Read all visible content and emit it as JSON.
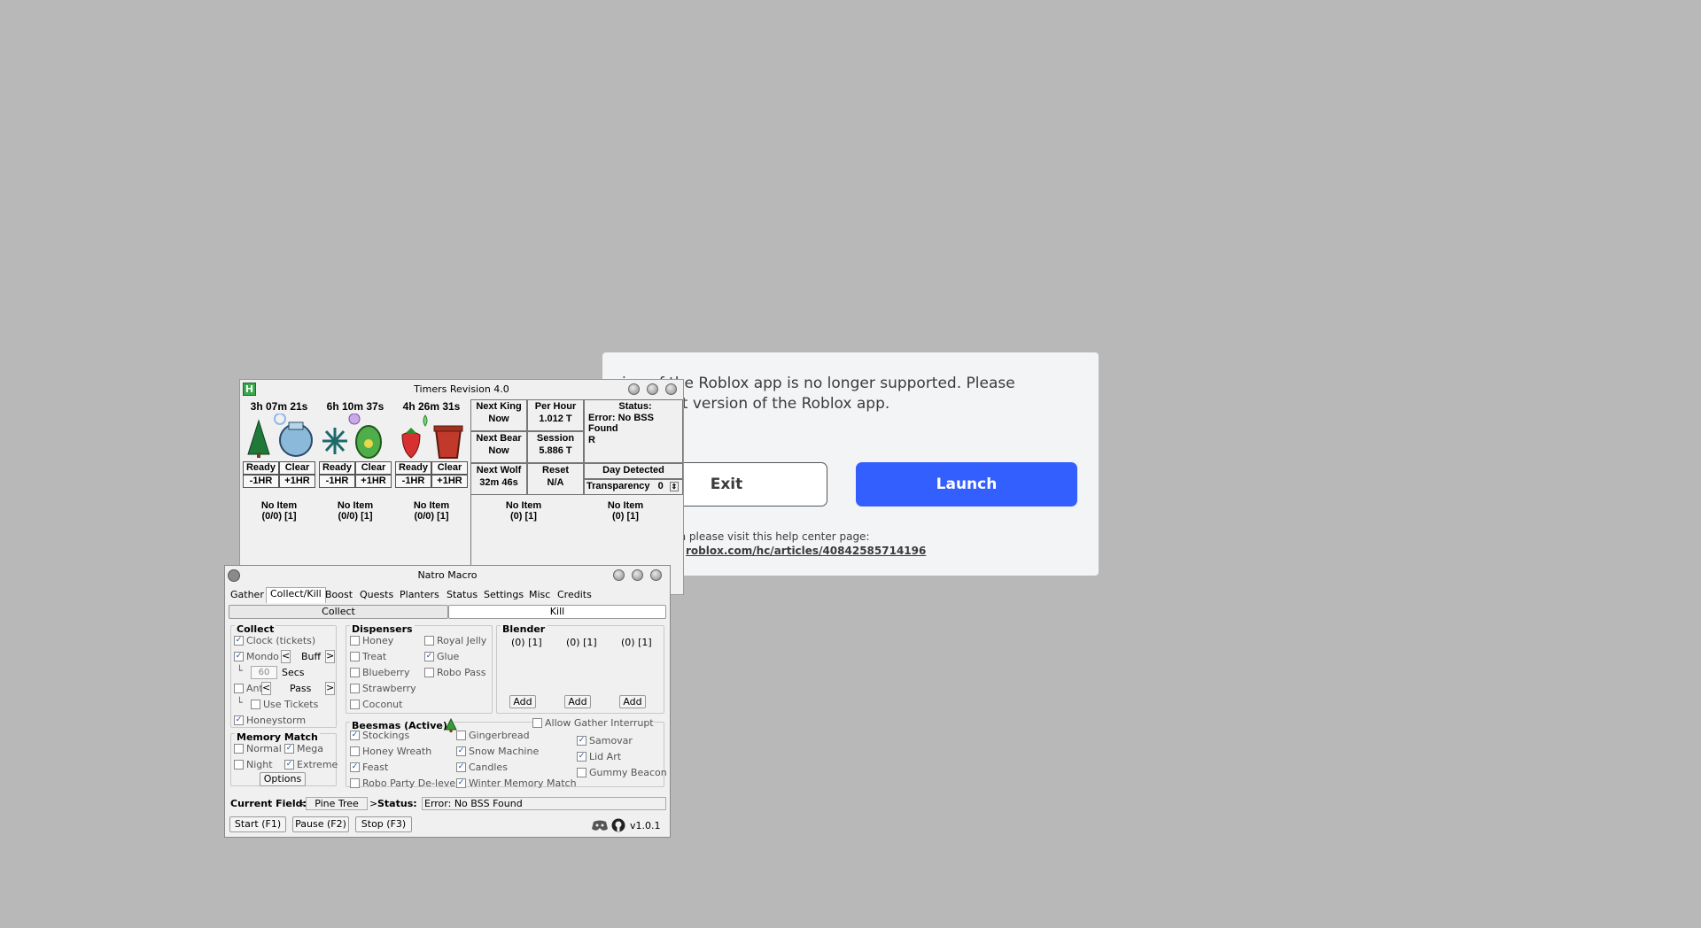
{
  "roblox": {
    "message": "ion of the Roblox app is no longer supported. Please\nhe latest version of the Roblox app.",
    "exit_label": "Exit",
    "launch_label": "Launch",
    "info_text": "ormation please visit this help center page:",
    "link_text": "roblox.com/hc/articles/40842585714196"
  },
  "timers": {
    "title": "Timers Revision 4.0",
    "planters": [
      {
        "time": "3h 07m 21s",
        "ready": "Ready",
        "clear": "Clear",
        "minus": "-1HR",
        "plus": "+1HR",
        "item": "No Item",
        "count": "(0/0) [1]"
      },
      {
        "time": "6h 10m 37s",
        "ready": "Ready",
        "clear": "Clear",
        "minus": "-1HR",
        "plus": "+1HR",
        "item": "No Item",
        "count": "(0/0) [1]"
      },
      {
        "time": "4h 26m 31s",
        "ready": "Ready",
        "clear": "Clear",
        "minus": "-1HR",
        "plus": "+1HR",
        "item": "No Item",
        "count": "(0/0) [1]"
      }
    ],
    "next_king_label": "Next King",
    "next_king_value": "Now",
    "next_bear_label": "Next Bear",
    "next_bear_value": "Now",
    "next_wolf_label": "Next Wolf",
    "next_wolf_value": "32m 46s",
    "per_hour_label": "Per Hour",
    "per_hour_value": "1.012 T",
    "session_label": "Session",
    "session_value": "5.886 T",
    "reset_label": "Reset",
    "reset_value": "N/A",
    "status_label": "Status:",
    "status_value": "Error: No BSS Found",
    "status_extra": "R",
    "day_label": "Day Detected",
    "transparency_label": "Transparency",
    "transparency_value": "0",
    "right_items": [
      {
        "item": "No Item",
        "count": "(0) [1]"
      },
      {
        "item": "No Item",
        "count": "(0) [1]"
      }
    ]
  },
  "natro": {
    "title": "Natro Macro",
    "tabs": [
      "Gather",
      "Collect/Kill",
      "Boost",
      "Quests",
      "Planters",
      "Status",
      "Settings",
      "Misc",
      "Credits"
    ],
    "collect_btn": "Collect",
    "kill_btn": "Kill",
    "collect": {
      "title": "Collect",
      "clock": "Clock (tickets)",
      "mondo": "Mondo",
      "mondo_option": "Buff",
      "secs_value": "60",
      "secs_label": "Secs",
      "ant": "Ant",
      "ant_option": "Pass",
      "use_tickets": "Use Tickets",
      "honeystorm": "Honeystorm"
    },
    "memory": {
      "title": "Memory Match",
      "normal": "Normal",
      "mega": "Mega",
      "night": "Night",
      "extreme": "Extreme",
      "options": "Options"
    },
    "dispensers": {
      "title": "Dispensers",
      "honey": "Honey",
      "treat": "Treat",
      "blueberry": "Blueberry",
      "strawberry": "Strawberry",
      "coconut": "Coconut",
      "royal_jelly": "Royal Jelly",
      "glue": "Glue",
      "robo_pass": "Robo Pass"
    },
    "blender": {
      "title": "Blender",
      "slots": [
        "(0) [1]",
        "(0) [1]",
        "(0) [1]"
      ],
      "add": "Add"
    },
    "beesmas": {
      "title": "Beesmas (Active)",
      "allow": "Allow Gather Interrupt",
      "stockings": "Stockings",
      "honey_wreath": "Honey Wreath",
      "feast": "Feast",
      "robo_party": "Robo Party De-level",
      "gingerbread": "Gingerbread",
      "snow_machine": "Snow Machine",
      "candles": "Candles",
      "winter_memory": "Winter Memory Match",
      "samovar": "Samovar",
      "lid_art": "Lid Art",
      "gummy_beacon": "Gummy Beacon"
    },
    "current_field_label": "Current Field:",
    "current_field": "Pine Tree",
    "status_label": "Status:",
    "status_value": "Error: No BSS Found",
    "start": "Start (F1)",
    "pause": "Pause (F2)",
    "stop": "Stop (F3)",
    "version": "v1.0.1"
  }
}
